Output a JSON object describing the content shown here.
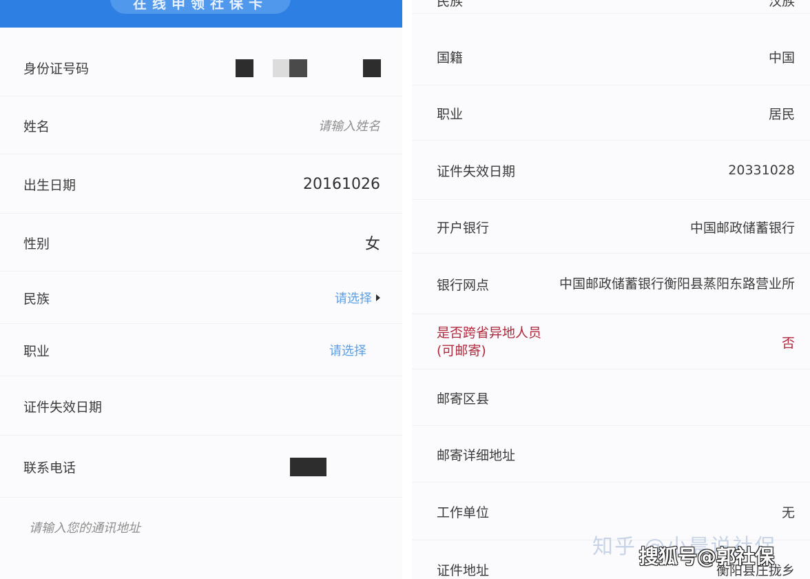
{
  "banner": {
    "title": "在线申领社保卡"
  },
  "left_form": {
    "id_number": {
      "label": "身份证号码"
    },
    "name": {
      "label": "姓名",
      "placeholder": "请输入姓名"
    },
    "birth_date": {
      "label": "出生日期",
      "value": "20161026"
    },
    "gender": {
      "label": "性别",
      "value": "女"
    },
    "ethnicity": {
      "label": "民族",
      "select_text": "请选择"
    },
    "occupation": {
      "label": "职业",
      "select_text": "请选择"
    },
    "expiry_date": {
      "label": "证件失效日期"
    },
    "phone": {
      "label": "联系电话"
    },
    "address": {
      "placeholder": "请输入您的通讯地址"
    }
  },
  "right_form": {
    "ethnicity": {
      "label": "民族",
      "value": "汉族"
    },
    "nationality": {
      "label": "国籍",
      "value": "中国"
    },
    "occupation": {
      "label": "职业",
      "value": "居民"
    },
    "expiry_date": {
      "label": "证件失效日期",
      "value": "20331028"
    },
    "bank": {
      "label": "开户银行",
      "value": "中国邮政储蓄银行"
    },
    "branch": {
      "label": "银行网点",
      "value": "中国邮政储蓄银行衡阳县蒸阳东路营业所"
    },
    "cross_province": {
      "label": "是否跨省异地人员(可邮寄)",
      "value": "否"
    },
    "mail_district": {
      "label": "邮寄区县"
    },
    "mail_address": {
      "label": "邮寄详细地址"
    },
    "employer": {
      "label": "工作单位",
      "value": "无"
    },
    "id_address": {
      "label": "证件地址",
      "value": "衡阳县庄拢乡"
    }
  },
  "watermarks": {
    "zhihu": "知乎 @小晨说社保",
    "sohu": "搜狐号@郭社保"
  },
  "colors": {
    "banner": "#2e7fe3",
    "select_link": "#5aa0e8",
    "alert_red": "#b0283c"
  }
}
